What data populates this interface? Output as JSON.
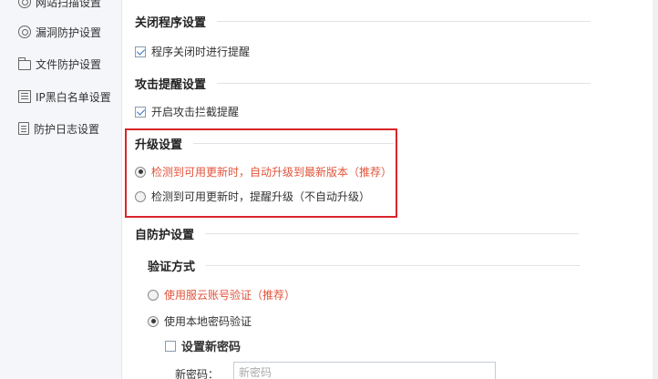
{
  "sidebar": {
    "items": [
      {
        "label": "网站扫描设置",
        "icon": "scan-icon"
      },
      {
        "label": "漏洞防护设置",
        "icon": "shield-icon"
      },
      {
        "label": "文件防护设置",
        "icon": "folder-icon"
      },
      {
        "label": "IP黑白名单设置",
        "icon": "list-icon"
      },
      {
        "label": "防护日志设置",
        "icon": "log-icon"
      }
    ]
  },
  "close_settings": {
    "title": "关闭程序设置",
    "option": {
      "label": "程序关闭时进行提醒",
      "checked": true
    }
  },
  "attack_alert": {
    "title": "攻击提醒设置",
    "option": {
      "label": "开启攻击拦截提醒",
      "checked": true
    }
  },
  "upgrade": {
    "title": "升级设置",
    "options": [
      {
        "label": "检测到可用更新时，自动升级到最新版本（推荐）",
        "checked": true
      },
      {
        "label": "检测到可用更新时，提醒升级（不自动升级）",
        "checked": false
      }
    ]
  },
  "self_protect": {
    "title": "自防护设置",
    "verify_title": "验证方式",
    "options": [
      {
        "label": "使用服云账号验证（推荐）",
        "checked": false
      },
      {
        "label": "使用本地密码验证",
        "checked": true
      }
    ],
    "new_password": {
      "label": "设置新密码",
      "checked": false
    },
    "password_label": "新密码：",
    "password_placeholder": "新密码"
  },
  "colors": {
    "highlight": "#d9252a",
    "accent_text": "#e2533a"
  }
}
